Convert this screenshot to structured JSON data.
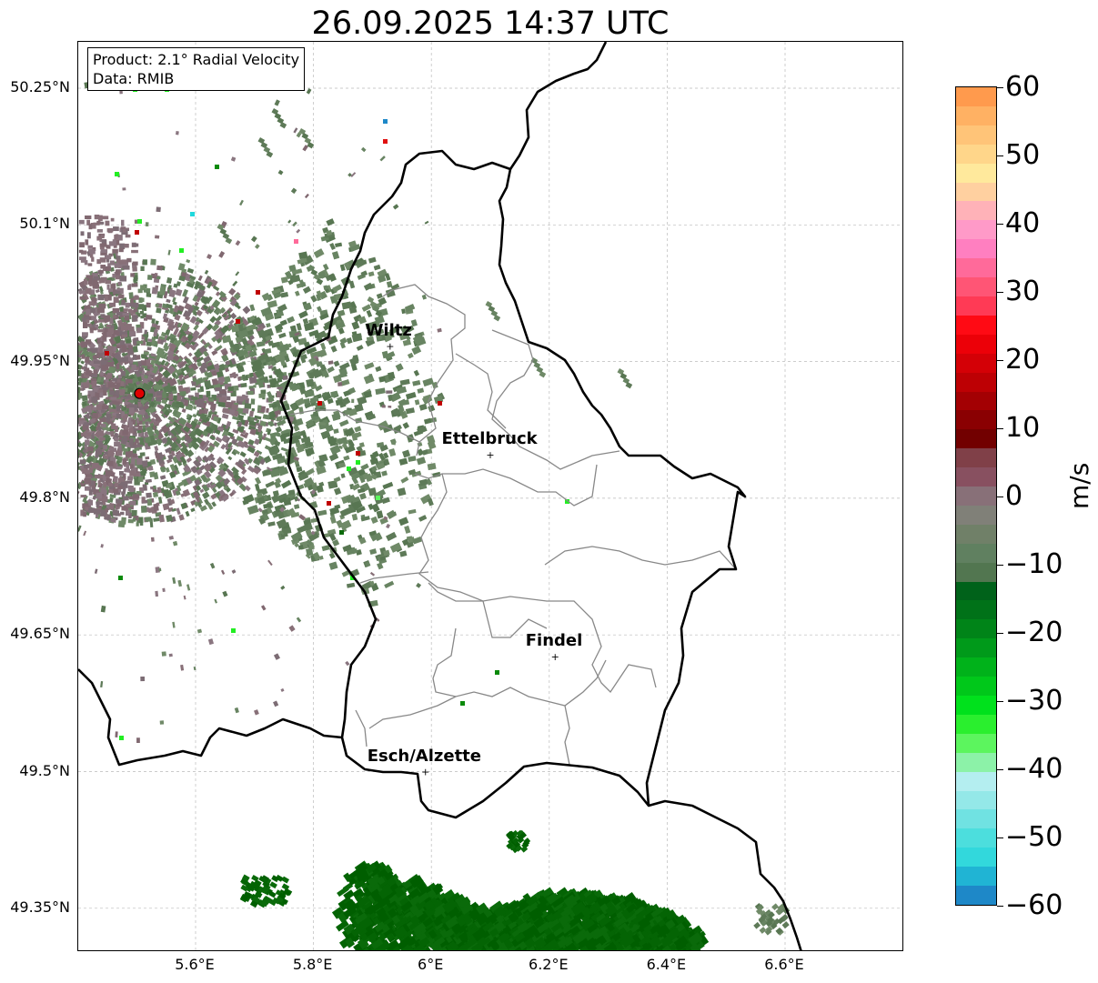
{
  "title": "26.09.2025 14:37 UTC",
  "info": {
    "product": "Product: 2.1° Radial Velocity",
    "data": "Data: RMIB"
  },
  "map": {
    "lon_range": [
      5.4,
      6.8
    ],
    "lat_range": [
      49.3,
      50.3
    ],
    "x_ticks": [
      "5.6°E",
      "5.8°E",
      "6°E",
      "6.2°E",
      "6.4°E",
      "6.6°E"
    ],
    "y_ticks": [
      "50.25°N",
      "50.1°N",
      "49.95°N",
      "49.8°N",
      "49.65°N",
      "49.5°N",
      "49.35°N"
    ],
    "grid": true,
    "radar_site": {
      "lon": 5.505,
      "lat": 49.915,
      "color": "#e00000"
    },
    "cities": [
      {
        "name": "Wiltz",
        "lon": 5.93,
        "lat": 49.967
      },
      {
        "name": "Ettelbruck",
        "lon": 6.1,
        "lat": 49.848
      },
      {
        "name": "Findel",
        "lon": 6.21,
        "lat": 49.626
      },
      {
        "name": "Esch/Alzette",
        "lon": 5.99,
        "lat": 49.5
      }
    ]
  },
  "colorbar": {
    "label": "m/s",
    "min": -60,
    "max": 60,
    "ticks": [
      "60",
      "50",
      "40",
      "30",
      "20",
      "10",
      "0",
      "−10",
      "−20",
      "−30",
      "−40",
      "−50",
      "−60"
    ],
    "colors": [
      "#ff9a4d",
      "#ffb163",
      "#ffc478",
      "#ffd68a",
      "#ffe99c",
      "#ffd0a0",
      "#ffb2b8",
      "#ff9ac8",
      "#ff7fc0",
      "#ff6a9a",
      "#ff5575",
      "#ff3a55",
      "#ff0a14",
      "#ec0008",
      "#d40006",
      "#bd0004",
      "#a30003",
      "#8a0002",
      "#720000",
      "#804048",
      "#885060",
      "#887078",
      "#808078",
      "#708068",
      "#608060",
      "#527650",
      "#00621a",
      "#007218",
      "#008418",
      "#009a1a",
      "#00b21a",
      "#00c81a",
      "#00e11c",
      "#2aef2e",
      "#5cf55e",
      "#8cf2a8",
      "#b4eef0",
      "#94e8e8",
      "#70e2e2",
      "#4cdedd",
      "#32d8dc",
      "#20b4d4",
      "#1e88c8"
    ]
  }
}
